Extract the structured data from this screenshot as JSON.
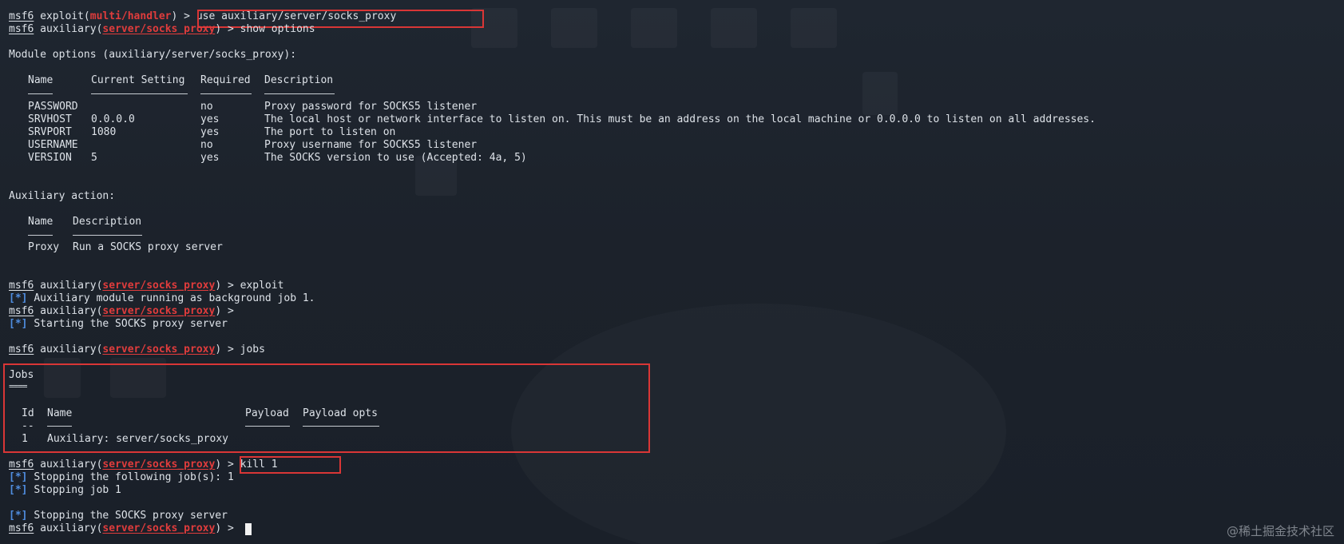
{
  "colors": {
    "background": "#1d232c",
    "text": "#dde2e8",
    "module": "#e03c3c",
    "status_star": "#4f8ddf",
    "highlight": "#d93636"
  },
  "prompt": {
    "msf": "msf6",
    "exploit_word": "exploit(",
    "handler_module": "multi/handler",
    "aux_word": "auxiliary(",
    "socks_module": "server/socks_proxy",
    "close": ") > "
  },
  "commands": {
    "use": "use auxiliary/server/socks_proxy",
    "show": "show options",
    "exploit": "exploit",
    "jobs": "jobs",
    "kill": "kill 1"
  },
  "module_options": {
    "title": "Module options (auxiliary/server/socks_proxy):",
    "headers": {
      "name": "Name",
      "current": "Current Setting",
      "required": "Required",
      "description": "Description"
    },
    "rows": [
      {
        "name": "PASSWORD",
        "current": "",
        "required": "no",
        "description": "Proxy password for SOCKS5 listener"
      },
      {
        "name": "SRVHOST",
        "current": "0.0.0.0",
        "required": "yes",
        "description": "The local host or network interface to listen on. This must be an address on the local machine or 0.0.0.0 to listen on all addresses."
      },
      {
        "name": "SRVPORT",
        "current": "1080",
        "required": "yes",
        "description": "The port to listen on"
      },
      {
        "name": "USERNAME",
        "current": "",
        "required": "no",
        "description": "Proxy username for SOCKS5 listener"
      },
      {
        "name": "VERSION",
        "current": "5",
        "required": "yes",
        "description": "The SOCKS version to use (Accepted: 4a, 5)"
      }
    ]
  },
  "aux_action": {
    "title": "Auxiliary action:",
    "headers": {
      "name": "Name",
      "description": "Description"
    },
    "rows": [
      {
        "name": "Proxy",
        "description": "Run a SOCKS proxy server"
      }
    ]
  },
  "status": {
    "star": "[*]",
    "bg_job": "Auxiliary module running as background job 1.",
    "starting": "Starting the SOCKS proxy server",
    "stopping_following": "Stopping the following job(s): 1",
    "stopping_job": "Stopping job 1",
    "stopping_server": "Stopping the SOCKS proxy server"
  },
  "jobs": {
    "title": "Jobs",
    "underline": "====",
    "headers": {
      "id": "Id",
      "name": "Name",
      "payload": "Payload",
      "payload_opts": "Payload opts"
    },
    "id_rule": "--",
    "rows": [
      {
        "id": "1",
        "name": "Auxiliary: server/socks_proxy",
        "payload": "",
        "payload_opts": ""
      }
    ]
  },
  "watermark": "@稀土掘金技术社区"
}
